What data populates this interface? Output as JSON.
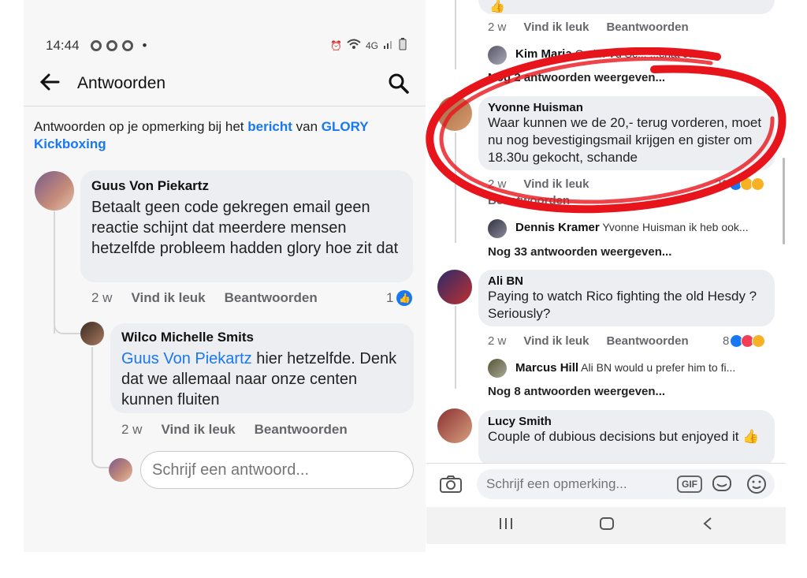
{
  "status": {
    "time": "14:44",
    "dot": "•",
    "network": "4G"
  },
  "header": {
    "title": "Antwoorden"
  },
  "context": {
    "prefix": "Antwoorden op je opmerking bij het ",
    "post_link": "bericht",
    "middle": " van ",
    "page_link": "GLORY Kickboxing"
  },
  "left_comments": [
    {
      "name": "Guus Von Piekartz",
      "text": "Betaalt  geen code gekregen  email geen reactie schijnt dat meerdere mensen hetzelfde probleem hadden glory hoe zit dat",
      "time": "2 w",
      "like": "Vind ik leuk",
      "reply": "Beantwoorden",
      "count": "1"
    },
    {
      "name": "Wilco Michelle Smits",
      "mention": "Guus Von Piekartz",
      "text": " hier hetzelfde. Denk dat we allemaal naar onze centen kunnen fluiten",
      "time": "2 w",
      "like": "Vind ik leuk",
      "reply": "Beantwoorden"
    }
  ],
  "reply_input": {
    "placeholder": "Schrijf een antwoord..."
  },
  "right": {
    "top_emoji": "👍",
    "top_meta": {
      "time": "2 w",
      "like": "Vind ik leuk",
      "reply": "Beantwoorden"
    },
    "reply1": {
      "name": "Kim Maria",
      "text": "Godfri Vd Sc... ...chat Jam..."
    },
    "more1": "Nog 2 antwoorden weergeven...",
    "c1": {
      "name": "Yvonne Huisman",
      "text": "Waar kunnen we de 20,- terug vorderen, moet nu nog bevestigingsmail krijgen en gister om 18.30u gekocht, schande",
      "time": "2 w",
      "like": "Vind ik leuk",
      "reply": "Beantwoorden",
      "count": "21"
    },
    "reply2": {
      "name": "Dennis Kramer",
      "text": "Yvonne Huisman ik heb ook..."
    },
    "more2": "Nog 33 antwoorden weergeven...",
    "c2": {
      "name": "Ali BN",
      "text": "Paying to watch Rico fighting the old Hesdy ? Seriously?",
      "time": "2 w",
      "like": "Vind ik leuk",
      "reply": "Beantwoorden",
      "count": "8"
    },
    "reply3": {
      "name": "Marcus Hill",
      "text": "Ali BN  would u prefer him to fi..."
    },
    "more3": "Nog 8 antwoorden weergeven...",
    "c3": {
      "name": "Lucy Smith",
      "text": "Couple of dubious decisions but enjoyed it 👍"
    },
    "comment_input": {
      "placeholder": "Schrijf een opmerking...",
      "gif": "GIF"
    }
  },
  "colors": {
    "link": "#1877f2",
    "annotation": "#e8141c",
    "bubble": "#eceef1",
    "meta": "#65676b"
  }
}
